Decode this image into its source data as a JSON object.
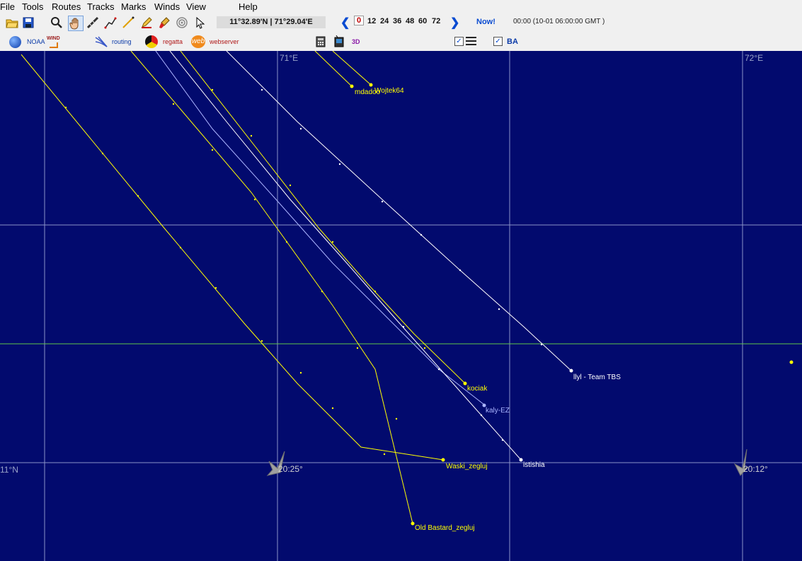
{
  "menu": [
    "File",
    "Tools",
    "Routes",
    "Tracks",
    "Marks",
    "Winds",
    "View",
    "Help"
  ],
  "toolbar": {
    "coordinates": "11°32.89'N | 71°29.04'E",
    "timesteps": [
      "0",
      "12",
      "24",
      "36",
      "48",
      "60",
      "72"
    ],
    "now_label": "Now!",
    "time_info": "00:00 (10-01 06:00:00 GMT )",
    "icons": [
      "open-folder-icon",
      "save-icon",
      "zoom-icon",
      "hand-pan-icon",
      "ruler-icon",
      "route-line-icon",
      "line-tool-icon",
      "mark-pen-icon",
      "brush-icon",
      "target-icon",
      "pointer-icon"
    ]
  },
  "toolbar2": {
    "noaa": "NOAA",
    "wind": "WIND",
    "routing": "routing",
    "regatta": "regatta",
    "web": "web",
    "webserver": "webserver",
    "three_d": "3D",
    "ba": "BA"
  },
  "grid": {
    "lon_labels": [
      "71°E",
      "72°E"
    ],
    "lat_labels": [
      "11°N"
    ]
  },
  "wind_labels": [
    "20:25°",
    "20:12°"
  ],
  "boats": [
    "mdadoo",
    "Wojtek64",
    "kociak",
    "kaly-EZ",
    "istishia",
    "llyl - Team TBS",
    "Waski_zegluj",
    "Old Bastard_zegluj"
  ],
  "colors": {
    "sea": "#020a6e",
    "yellow_track": "#ffff00",
    "white_track": "#ffffff",
    "grid": "#8b92c8",
    "highlight_grid": "#5fc44b"
  }
}
